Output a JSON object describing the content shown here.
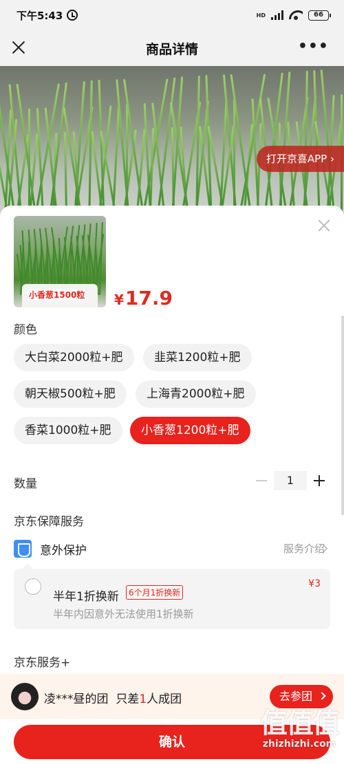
{
  "status_bar": {
    "time": "下午5:43",
    "network": "HD",
    "battery": "66"
  },
  "nav": {
    "title": "商品详情"
  },
  "hero": {
    "open_app_label": "打开京喜APP ›"
  },
  "product": {
    "thumb_label": "小香葱1500粒",
    "currency": "¥",
    "price": "17.9"
  },
  "color": {
    "label": "颜色",
    "options": [
      "大白菜2000粒+肥",
      "韭菜1200粒+肥",
      "朝天椒500粒+肥",
      "上海青2000粒+肥",
      "香菜1000粒+肥",
      "小香葱1200粒+肥"
    ],
    "selected": "小香葱1200粒+肥"
  },
  "quantity": {
    "label": "数量",
    "value": "1"
  },
  "guarantee": {
    "title": "京东保障服务",
    "protect_label": "意外保护",
    "service_intro": "服务介绍",
    "plan": {
      "title": "半年1折换新",
      "tag": "6个月1折换新",
      "desc": "半年内因意外无法使用1折换新",
      "price": "¥3"
    }
  },
  "jd_plus": {
    "label": "京东服务+"
  },
  "group": {
    "user": "凌***昼的团",
    "text_prefix": "只差",
    "count": "1",
    "text_suffix": "人成团",
    "join_label": "去参团"
  },
  "confirm": {
    "label": "确认"
  },
  "watermark": {
    "logo": "值值值",
    "text": "zhizhizhi.com"
  }
}
